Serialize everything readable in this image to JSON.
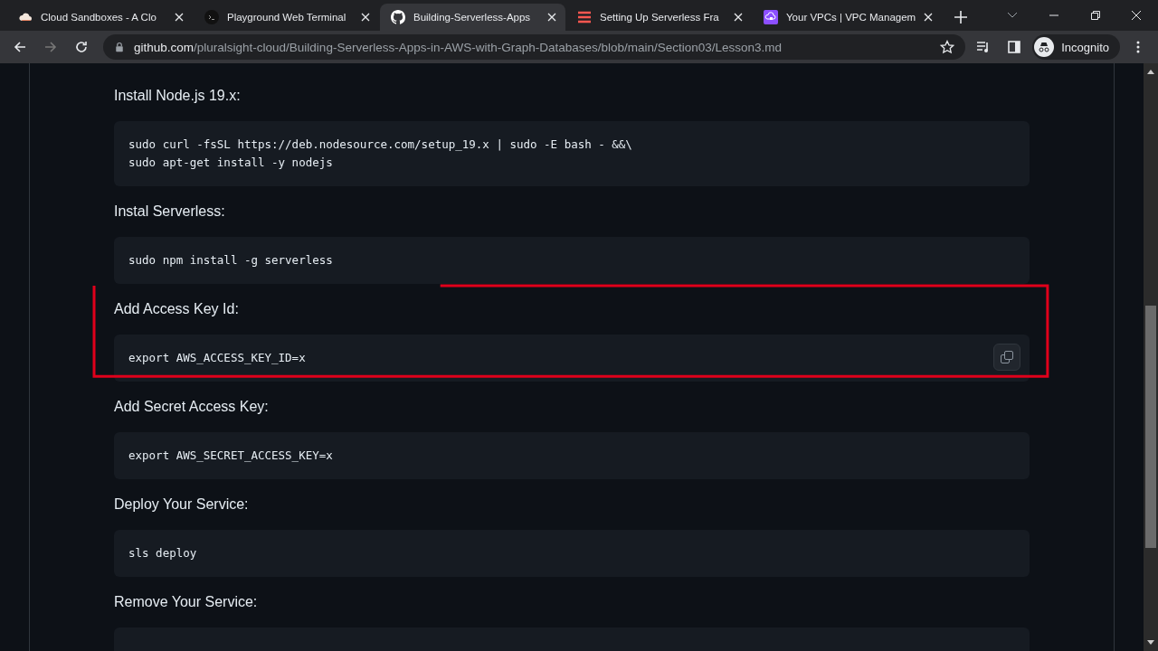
{
  "tabs": [
    {
      "title": "Cloud Sandboxes - A Clo",
      "selected": false
    },
    {
      "title": "Playground Web Terminal",
      "selected": false
    },
    {
      "title": "Building-Serverless-Apps",
      "selected": true
    },
    {
      "title": "Setting Up Serverless Fra",
      "selected": false
    },
    {
      "title": "Your VPCs | VPC Managem",
      "selected": false
    }
  ],
  "address_bar": {
    "domain": "github.com",
    "path": "/pluralsight-cloud/Building-Serverless-Apps-in-AWS-with-Graph-Databases/blob/main/Section03/Lesson3.md",
    "profile": "Incognito"
  },
  "sections": [
    {
      "heading": "Install Node.js 19.x:",
      "code": [
        "sudo curl -fsSL https://deb.nodesource.com/setup_19.x | sudo -E bash - &&\\",
        "sudo apt-get install -y nodejs"
      ],
      "highlighted": false,
      "hovered": false
    },
    {
      "heading": "Instal Serverless:",
      "code": [
        "sudo npm install -g serverless"
      ],
      "highlighted": false,
      "hovered": false
    },
    {
      "heading": "Add Access Key Id:",
      "code": [
        "export AWS_ACCESS_KEY_ID=x"
      ],
      "highlighted": true,
      "hovered": true
    },
    {
      "heading": "Add Secret Access Key:",
      "code": [
        "export AWS_SECRET_ACCESS_KEY=x"
      ],
      "highlighted": false,
      "hovered": false
    },
    {
      "heading": "Deploy Your Service:",
      "code": [
        "sls deploy"
      ],
      "highlighted": false,
      "hovered": false
    },
    {
      "heading": "Remove Your Service:",
      "highlighted": false,
      "hovered": false
    }
  ]
}
